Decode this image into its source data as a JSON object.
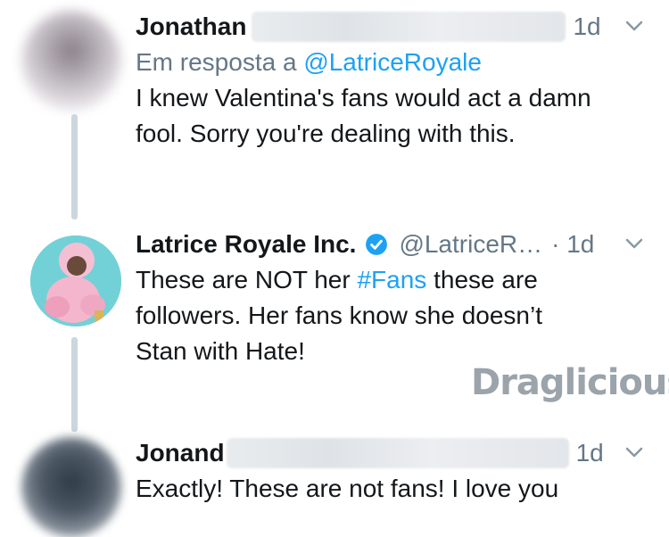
{
  "tweets": [
    {
      "name": "Jonathan",
      "time": "1d",
      "reply_prefix": "Em resposta a",
      "reply_mention": "@LatriceRoyale",
      "body": "I knew Valentina's fans would act a damn fool. Sorry you're dealing with this."
    },
    {
      "name": "Latrice Royale Inc.",
      "handle": "@LatriceR…",
      "time": "· 1d",
      "body_before": "These are NOT her ",
      "hashtag": "#Fans",
      "body_line1_after": " these are",
      "body_line2": "followers. Her fans know she doesn’t",
      "body_line3": "Stan with Hate!"
    },
    {
      "name": "Jonand",
      "time": "1d",
      "body": "Exactly!  These are not fans!  I love you"
    }
  ],
  "watermark": "Draglicious",
  "icons": {
    "chevron": "chevron-down-icon",
    "verified": "verified-badge-icon"
  },
  "colors": {
    "link": "#1da1f2",
    "muted": "#657786",
    "thread_line": "#ccd6dd",
    "verified": "#1da1f2"
  }
}
